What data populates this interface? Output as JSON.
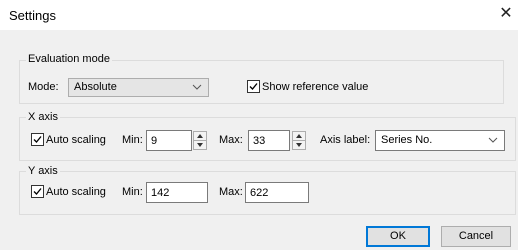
{
  "window": {
    "title": "Settings",
    "close_glyph": "✕"
  },
  "evaluation": {
    "legend": "Evaluation mode",
    "mode_label": "Mode:",
    "mode_value": "Absolute",
    "show_reference_label": "Show reference value",
    "show_reference_checked": true
  },
  "x_axis": {
    "legend": "X axis",
    "auto_scaling_label": "Auto scaling",
    "auto_scaling_checked": true,
    "min_label": "Min:",
    "min_value": "9",
    "max_label": "Max:",
    "max_value": "33",
    "axis_label_label": "Axis label:",
    "axis_label_value": "Series No."
  },
  "y_axis": {
    "legend": "Y axis",
    "auto_scaling_label": "Auto scaling",
    "auto_scaling_checked": true,
    "min_label": "Min:",
    "min_value": "142",
    "max_label": "Max:",
    "max_value": "622"
  },
  "buttons": {
    "ok": "OK",
    "cancel": "Cancel"
  },
  "colors": {
    "default_button_border": "#0078d7",
    "window_bg": "#f0f0f0"
  }
}
